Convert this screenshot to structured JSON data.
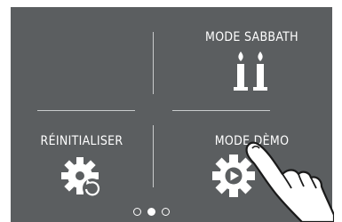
{
  "tiles": {
    "sabbath": {
      "label": "MODE SABBATH",
      "icon": "candles-icon"
    },
    "reset": {
      "label": "RÉINITIALISER",
      "icon": "gear-reset-icon"
    },
    "demo": {
      "label": "MODE DÈMO",
      "icon": "gear-play-icon"
    }
  },
  "pager": {
    "pages": 3,
    "current": 2
  },
  "colors": {
    "screen_background": "#5b5e60",
    "text": "#ffffff",
    "divider": "#c9cbcc"
  }
}
